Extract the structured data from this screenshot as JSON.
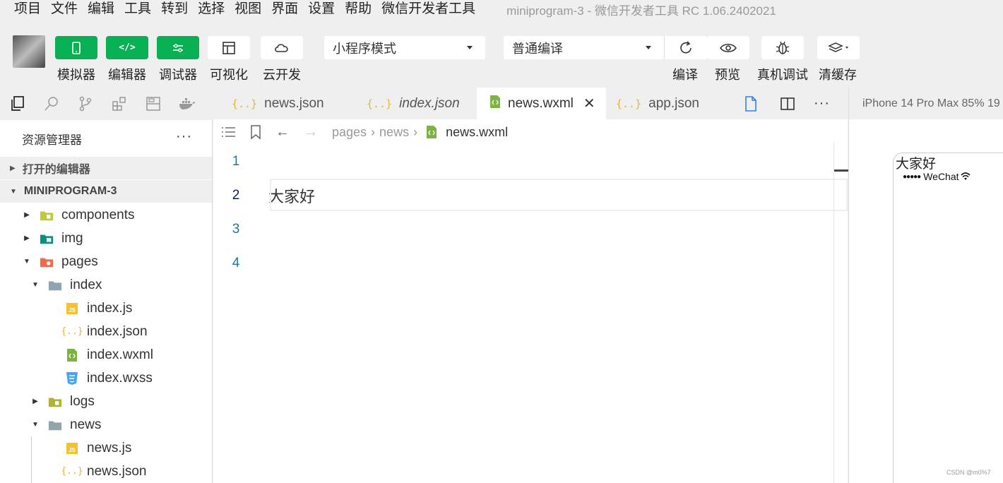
{
  "menu": {
    "items": [
      "项目",
      "文件",
      "编辑",
      "工具",
      "转到",
      "选择",
      "视图",
      "界面",
      "设置",
      "帮助",
      "微信开发者工具"
    ],
    "window_title": "miniprogram-3  -  微信开发者工具 RC 1.06.2402021"
  },
  "toolbar": {
    "simulator_label": "模拟器",
    "editor_label": "编辑器",
    "debugger_label": "调试器",
    "visual_label": "可视化",
    "cloud_label": "云开发",
    "mode_select": "小程序模式",
    "compile_select": "普通编译",
    "compile_label": "编译",
    "preview_label": "预览",
    "remote_debug_label": "真机调试",
    "clear_cache_label": "清缓存"
  },
  "sidebar": {
    "title": "资源管理器",
    "more": "···",
    "open_editors": "打开的编辑器",
    "project": "MINIPROGRAM-3",
    "tree": [
      {
        "label": "components"
      },
      {
        "label": "img"
      },
      {
        "label": "pages"
      },
      {
        "label": "index"
      },
      {
        "label": "index.js"
      },
      {
        "label": "index.json"
      },
      {
        "label": "index.wxml"
      },
      {
        "label": "index.wxss"
      },
      {
        "label": "logs"
      },
      {
        "label": "news"
      },
      {
        "label": "news.js"
      },
      {
        "label": "news.json"
      }
    ]
  },
  "tabs": [
    {
      "label": "news.json"
    },
    {
      "label": "index.json"
    },
    {
      "label": "news.wxml"
    },
    {
      "label": "app.json"
    }
  ],
  "breadcrumb": {
    "pages": "pages",
    "news": "news",
    "file": "news.wxml"
  },
  "editor": {
    "lines": [
      {
        "num": "1",
        "text": ""
      },
      {
        "num": "2",
        "text": "大家好"
      },
      {
        "num": "3",
        "text": ""
      },
      {
        "num": "4",
        "text": ""
      }
    ]
  },
  "device": {
    "label": "iPhone 14 Pro Max 85% 19",
    "page_text": "大家好",
    "signal": "●●●●●",
    "carrier": "WeChat"
  },
  "watermark": "CSDN @m0%7",
  "colors": {
    "accent_green": "#07b053",
    "json_icon": "#e8b62c",
    "wxml_icon": "#7cb342",
    "line_number": "#237893"
  }
}
